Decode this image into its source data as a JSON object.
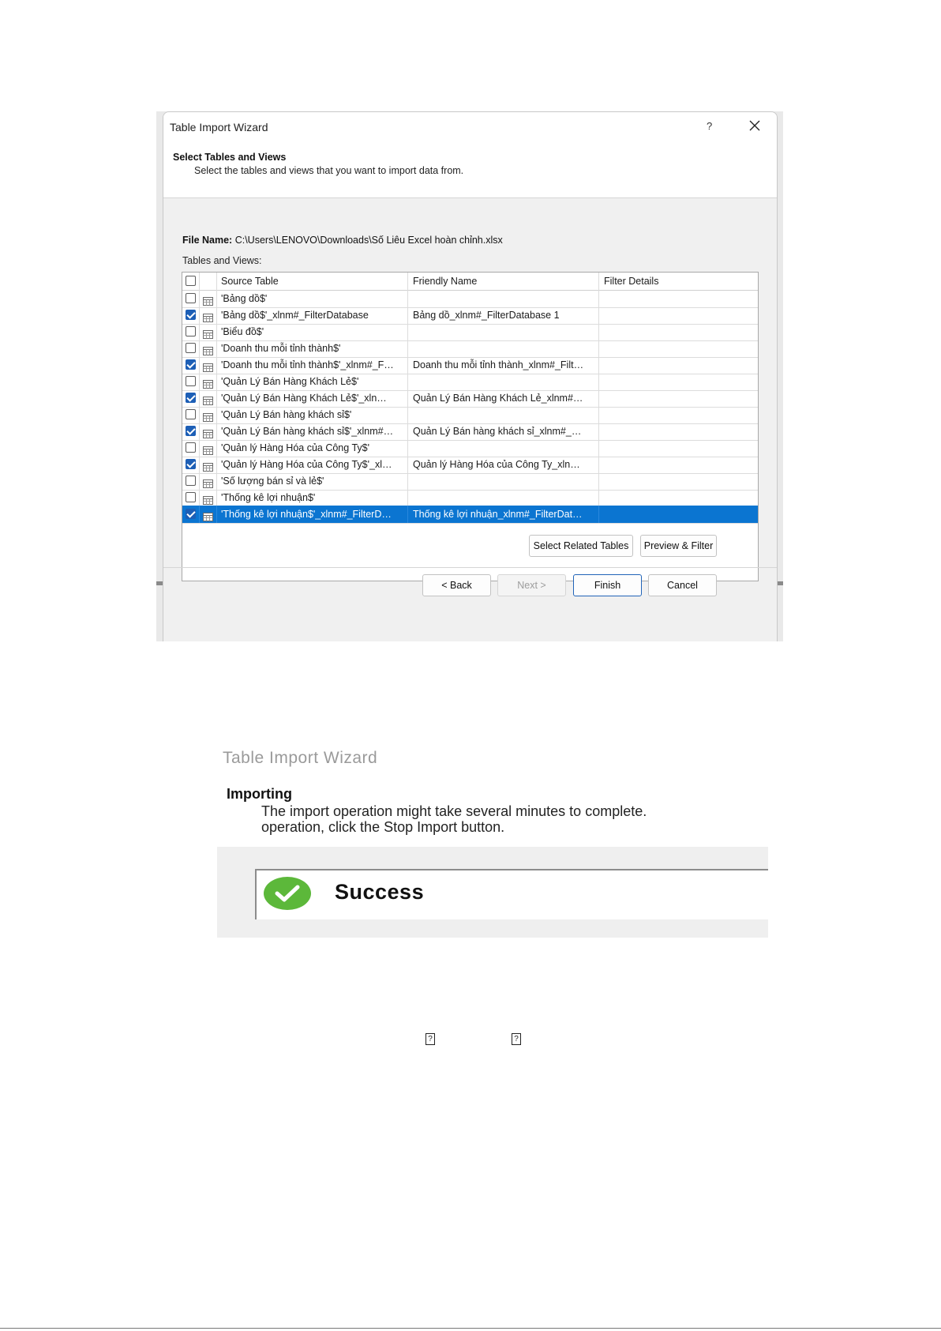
{
  "wizard": {
    "window_title": "Table Import Wizard",
    "help_label": "?",
    "section_title": "Select Tables and Views",
    "section_desc": "Select the tables and views that you want to import data from.",
    "file_label": "File Name:",
    "file_path": "C:\\Users\\LENOVO\\Downloads\\Số Liêu Excel hoàn chỉnh.xlsx",
    "tables_label": "Tables and Views:",
    "columns": [
      "Source Table",
      "Friendly Name",
      "Filter Details"
    ],
    "rows": [
      {
        "checked": false,
        "selected": false,
        "source": "'Bảng dồ$'",
        "friendly": "",
        "filter": ""
      },
      {
        "checked": true,
        "selected": false,
        "source": "'Bảng dồ$'_xlnm#_FilterDatabase",
        "friendly": "Bảng dồ_xlnm#_FilterDatabase 1",
        "filter": ""
      },
      {
        "checked": false,
        "selected": false,
        "source": "'Biểu đồ$'",
        "friendly": "",
        "filter": ""
      },
      {
        "checked": false,
        "selected": false,
        "source": "'Doanh thu mỗi tỉnh thành$'",
        "friendly": "",
        "filter": ""
      },
      {
        "checked": true,
        "selected": false,
        "source": "'Doanh thu mỗi tỉnh thành$'_xlnm#_F…",
        "friendly": "Doanh thu mỗi tỉnh thành_xlnm#_Filt…",
        "filter": ""
      },
      {
        "checked": false,
        "selected": false,
        "source": "'Quản Lý Bán Hàng Khách Lẻ$'",
        "friendly": "",
        "filter": ""
      },
      {
        "checked": true,
        "selected": false,
        "source": "'Quản Lý Bán Hàng Khách Lẻ$'_xln…",
        "friendly": "Quản Lý Bán Hàng Khách Lẻ_xlnm#…",
        "filter": ""
      },
      {
        "checked": false,
        "selected": false,
        "source": "'Quản Lý Bán hàng khách sỉ$'",
        "friendly": "",
        "filter": ""
      },
      {
        "checked": true,
        "selected": false,
        "source": "'Quản Lý Bán hàng khách sỉ$'_xlnm#…",
        "friendly": "Quản Lý Bán hàng khách sỉ_xlnm#_…",
        "filter": ""
      },
      {
        "checked": false,
        "selected": false,
        "source": "'Quản lý Hàng Hóa của Công Ty$'",
        "friendly": "",
        "filter": ""
      },
      {
        "checked": true,
        "selected": false,
        "source": "'Quản lý Hàng Hóa của Công Ty$'_xl…",
        "friendly": "Quản lý Hàng Hóa của Công Ty_xln…",
        "filter": ""
      },
      {
        "checked": false,
        "selected": false,
        "source": "'Số lượng bán sỉ và lẻ$'",
        "friendly": "",
        "filter": ""
      },
      {
        "checked": false,
        "selected": false,
        "source": "'Thống kê lợi nhuận$'",
        "friendly": "",
        "filter": ""
      },
      {
        "checked": true,
        "selected": true,
        "source": "'Thống kê lợi nhuận$'_xlnm#_FilterD…",
        "friendly": "Thống kê lợi nhuận_xlnm#_FilterDat…",
        "filter": ""
      }
    ],
    "buttons": {
      "select_related": "Select Related Tables",
      "preview_filter": "Preview & Filter",
      "back": "< Back",
      "next": "Next >",
      "finish": "Finish",
      "cancel": "Cancel"
    },
    "colors": {
      "selected_row": "#0b75d1",
      "checkbox_on": "#1d5fb6"
    }
  },
  "import_status": {
    "window_title": "Table Import Wizard",
    "section_title": "Importing",
    "desc_line1": "The import operation might take several minutes to complete.",
    "desc_line2": "operation, click the Stop Import button.",
    "status": "Success",
    "status_icon": "success-check-icon",
    "status_color": "#5cb83a"
  },
  "placeholders": [
    "?",
    "?"
  ]
}
